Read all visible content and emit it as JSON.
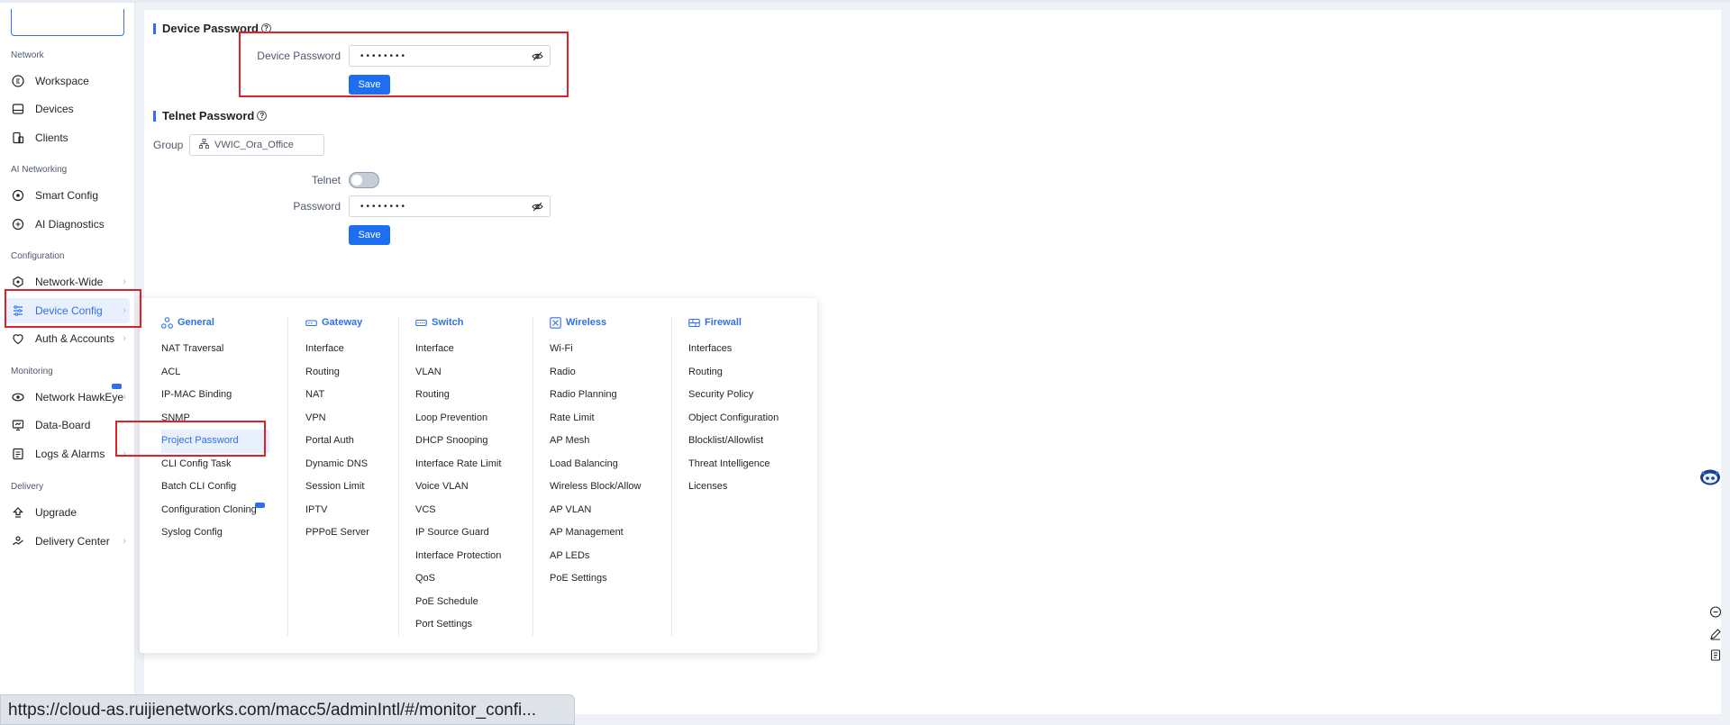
{
  "sidebar": {
    "sections": [
      {
        "label": "Network"
      },
      {
        "label": "AI Networking"
      },
      {
        "label": "Configuration"
      },
      {
        "label": "Monitoring"
      },
      {
        "label": "Delivery"
      }
    ],
    "items": [
      {
        "label": "Workspace",
        "icon": "workspace-icon"
      },
      {
        "label": "Devices",
        "icon": "devices-icon"
      },
      {
        "label": "Clients",
        "icon": "clients-icon"
      },
      {
        "label": "Smart Config",
        "icon": "smart-config-icon"
      },
      {
        "label": "AI Diagnostics",
        "icon": "ai-diagnostics-icon"
      },
      {
        "label": "Network-Wide",
        "icon": "network-wide-icon"
      },
      {
        "label": "Device Config",
        "icon": "device-config-icon"
      },
      {
        "label": "Auth & Accounts",
        "icon": "auth-accounts-icon"
      },
      {
        "label": "Network HawkEye",
        "icon": "hawkeye-icon"
      },
      {
        "label": "Data-Board",
        "icon": "data-board-icon"
      },
      {
        "label": "Logs & Alarms",
        "icon": "logs-alarms-icon"
      },
      {
        "label": "Upgrade",
        "icon": "upgrade-icon"
      },
      {
        "label": "Delivery Center",
        "icon": "delivery-center-icon"
      }
    ]
  },
  "device_password": {
    "title": "Device Password",
    "field_label": "Device Password",
    "value": "••••••••",
    "save_label": "Save"
  },
  "telnet_password": {
    "title": "Telnet Password",
    "group_label": "Group",
    "group_value": "VWIC_Ora_Office",
    "telnet_label": "Telnet",
    "telnet_enabled": false,
    "password_label": "Password",
    "password_value": "••••••••",
    "save_label": "Save"
  },
  "flyout": {
    "columns": [
      {
        "title": "General",
        "icon": "general-icon",
        "items": [
          "NAT Traversal",
          "ACL",
          "IP-MAC Binding",
          "SNMP",
          "Project Password",
          "CLI Config Task",
          "Batch CLI Config",
          "Configuration Cloning",
          "Syslog Config"
        ]
      },
      {
        "title": "Gateway",
        "icon": "gateway-icon",
        "items": [
          "Interface",
          "Routing",
          "NAT",
          "VPN",
          "Portal Auth",
          "Dynamic DNS",
          "Session Limit",
          "IPTV",
          "PPPoE Server"
        ]
      },
      {
        "title": "Switch",
        "icon": "switch-icon",
        "items": [
          "Interface",
          "VLAN",
          "Routing",
          "Loop Prevention",
          "DHCP Snooping",
          "Interface Rate Limit",
          "Voice VLAN",
          "VCS",
          "IP Source Guard",
          "Interface Protection",
          "QoS",
          "PoE Schedule",
          "Port Settings"
        ]
      },
      {
        "title": "Wireless",
        "icon": "wireless-icon",
        "items": [
          "Wi-Fi",
          "Radio",
          "Radio Planning",
          "Rate Limit",
          "AP Mesh",
          "Load Balancing",
          "Wireless Block/Allow",
          "AP VLAN",
          "AP Management",
          "AP LEDs",
          "PoE Settings"
        ]
      },
      {
        "title": "Firewall",
        "icon": "firewall-icon",
        "items": [
          "Interfaces",
          "Routing",
          "Security Policy",
          "Object Configuration",
          "Blocklist/Allowlist",
          "Threat Intelligence",
          "Licenses"
        ]
      }
    ]
  },
  "status_bar": {
    "url": "https://cloud-as.ruijienetworks.com/macc5/adminIntl/#/monitor_confi..."
  },
  "colors": {
    "accent": "#2f6fed",
    "highlight": "#e0202a"
  }
}
